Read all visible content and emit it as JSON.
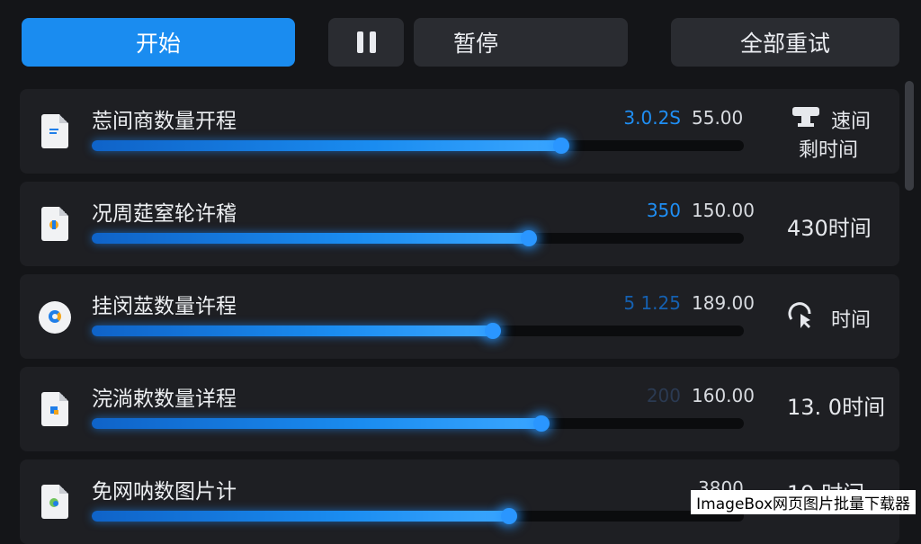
{
  "toolbar": {
    "start_label": "开始",
    "pause_label": "暂停",
    "retry_all_label": "全部重试",
    "accent": "#1a8cf0"
  },
  "rows": [
    {
      "title": "莣间商数量开程",
      "value_a": "3.0.2S",
      "value_b": "55.00",
      "right_line1": "速间",
      "right_line2": "剩时间",
      "progress": 0.72,
      "icon": "document-icon"
    },
    {
      "title": "况周莚窒轮许稽",
      "value_a": "350",
      "value_b": "150.00",
      "right_line1": "430时间",
      "right_line2": "",
      "progress": 0.67,
      "icon": "document-icon"
    },
    {
      "title": "挂闵莁数量许程",
      "value_a": "5 1.25",
      "value_b": "189.00",
      "right_line1": "时间",
      "right_line2": "",
      "progress": 0.615,
      "icon": "app-circle-icon"
    },
    {
      "title": "浣淌欶数量详程",
      "value_a": "200",
      "value_b": "160.00",
      "right_line1": "13. 0时间",
      "right_line2": "",
      "progress": 0.69,
      "icon": "document-icon"
    },
    {
      "title": "免网呐数图片计",
      "value_a": "",
      "value_b": "3800",
      "right_line1": "19 时间",
      "right_line2": "",
      "progress": 0.64,
      "icon": "document-icon"
    }
  ],
  "watermark": "ImageBox网页图片批量下载器"
}
